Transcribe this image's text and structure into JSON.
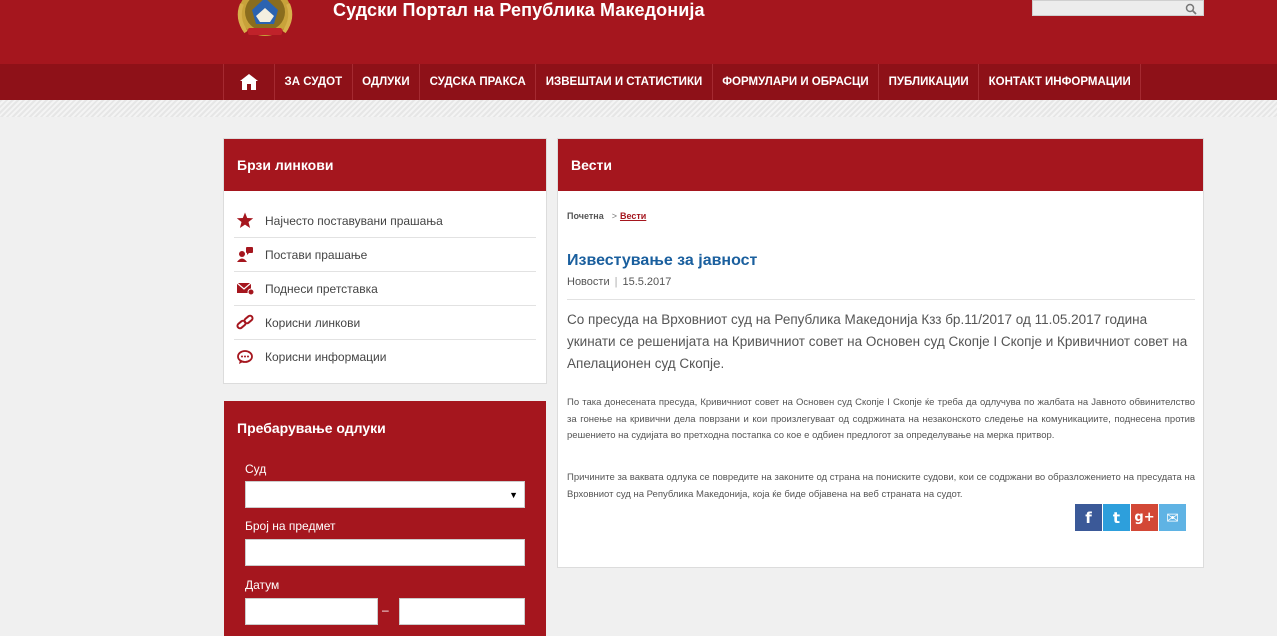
{
  "header": {
    "site_title": "Судски Портал на Република Македонија",
    "search_placeholder": ""
  },
  "nav": {
    "home_icon": "home-icon",
    "items": [
      "ЗА СУДОТ",
      "ОДЛУКИ",
      "СУДСКА ПРАКСА",
      "ИЗВЕШТАИ И СТАТИСТИКИ",
      "ФОРМУЛАРИ И ОБРАСЦИ",
      "ПУБЛИКАЦИИ",
      "КОНТАКТ ИНФОРМАЦИИ"
    ]
  },
  "quick_links": {
    "title": "Брзи линкови",
    "items": [
      {
        "label": "Најчесто поставувани прашања",
        "icon": "star-icon"
      },
      {
        "label": "Постави прашање",
        "icon": "user-question-icon"
      },
      {
        "label": "Поднеси претставка",
        "icon": "mail-icon"
      },
      {
        "label": "Корисни линкови",
        "icon": "link-icon"
      },
      {
        "label": "Корисни информации",
        "icon": "chat-icon"
      }
    ]
  },
  "decision_search": {
    "title": "Пребарување одлуки",
    "court_label": "Суд",
    "court_value": "",
    "case_label": "Број на предмет",
    "date_label": "Датум",
    "date_separator": "–"
  },
  "news": {
    "title": "Вести",
    "breadcrumb": {
      "home": "Почетна",
      "separator": ">",
      "current": "Вести"
    },
    "article": {
      "title": "Известување за јавност",
      "category": "Новости",
      "meta_separator": "|",
      "date": "15.5.2017",
      "lead": "Со пресуда на Врховниот суд на Република Македонија Кзз бр.11/2017 од 11.05.2017 година укинати се решенијата на Кривичниот совет на Основен суд Скопје I Скопје и Кривичниот совет на Апелационен суд Скопје.",
      "paragraph1": "По така донесената пресуда, Кривичниот совет на Основен суд Скопје I Скопје ќе треба да одлучува по жалбата на Јавното обвинителство за гонење на кривични дела поврзани и кои произлегуваат од содржината на незаконското следење на комуникациите, поднесена против решението на судијата во претходна постапка со кое е одбиен предлогот за определување на мерка притвор.",
      "paragraph2": "Причините за ваквата одлука се повредите на законите од страна на пониските судови, кои се содржани во образложението на пресудата на Врховниот суд на Република Македонија, која ќе биде објавена на веб страната на судот."
    },
    "share": [
      {
        "name": "facebook",
        "glyph": "f",
        "color": "#3b5998"
      },
      {
        "name": "twitter",
        "glyph": "t",
        "color": "#2d9fdc"
      },
      {
        "name": "google-plus",
        "glyph": "g+",
        "color": "#d34836"
      },
      {
        "name": "email",
        "glyph": "✉",
        "color": "#5fb3e4"
      }
    ]
  },
  "colors": {
    "brand_red": "#a5161e",
    "nav_dark": "#8e1118",
    "title_blue": "#1a5f9e"
  }
}
